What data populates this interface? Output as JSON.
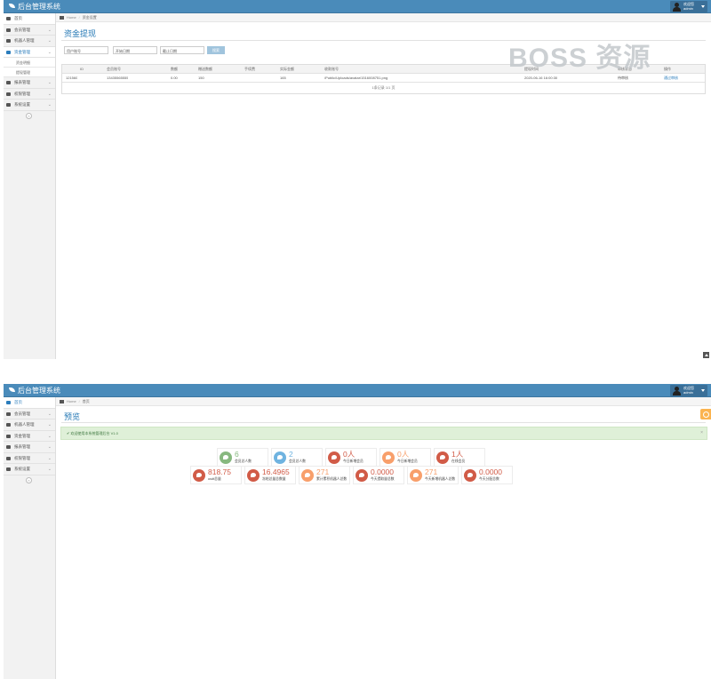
{
  "app": {
    "title": "后台管理系统"
  },
  "user": {
    "welcome": "欢迎您",
    "name": "admin"
  },
  "colors": {
    "navbar": "#4a8bba",
    "accent": "#2679b5",
    "green": "#87b87f",
    "blue": "#6fb3e0",
    "red": "#d15b47",
    "orange": "#f89f6b",
    "alert_bg": "#dff0d8"
  },
  "sidebar_icons": [
    "tachometer-icon",
    "edit-icon",
    "star-icon",
    "calendar-icon",
    "calendar-icon",
    "file-icon",
    "text-icon"
  ],
  "screen1": {
    "breadcrumb": {
      "home": "Home",
      "current": "资金设置"
    },
    "sidebar": {
      "home": "首页",
      "items": [
        "会员管理",
        "机器人管理",
        "资金管理",
        "报表管理",
        "权限管理",
        "系统设置"
      ],
      "submenu": [
        "资金明细",
        "提现管理"
      ]
    },
    "page_title": "资金提现",
    "filters": {
      "phone": "用户账号",
      "start": "开始日期",
      "end": "截止日期",
      "search": "搜索"
    },
    "table": {
      "headers": [
        "ID",
        "会员账号",
        "数额",
        "赠送数额",
        "手续费",
        "实际金额",
        "收款账号",
        "",
        "提现时间",
        "审核状态",
        "操作"
      ],
      "rows": [
        [
          "121560",
          "13435565555",
          "0.00",
          "150",
          "",
          "165",
          "/Public/Uploads/avatar/1516008751.png",
          "",
          "2020-06-16 16:00:30",
          "待审核",
          "通过审核"
        ]
      ],
      "footer": "1条记录 1/1 页"
    },
    "watermark": "BOSS 资源"
  },
  "screen2": {
    "breadcrumb": {
      "home": "Home",
      "current": "首页"
    },
    "sidebar": {
      "home": "首页",
      "items": [
        "会员管理",
        "机器人管理",
        "资金管理",
        "报表管理",
        "权限管理",
        "系统设置"
      ]
    },
    "page_title": "预览",
    "alert": "欢迎使用本系统管理后台 V1.0",
    "stats": [
      {
        "value": "6",
        "label": "会员总人数",
        "color": "#87b87f"
      },
      {
        "value": "2",
        "label": "会员总人数",
        "color": "#6fb3e0"
      },
      {
        "value": "0人",
        "label": "今日新增会员",
        "color": "#d15b47"
      },
      {
        "value": "0人",
        "label": "今日新增会员",
        "color": "#f89f6b"
      },
      {
        "value": "1人",
        "label": "在线会员",
        "color": "#d15b47"
      },
      {
        "value": "818.75",
        "label": "usdt总量",
        "color": "#d15b47"
      },
      {
        "value": "16.4965",
        "label": "冻结总量总数量",
        "color": "#d15b47"
      },
      {
        "value": "271",
        "label": "累计累积机器人总数",
        "color": "#f89f6b"
      },
      {
        "value": "0.0000",
        "label": "今天提取量总数",
        "color": "#d15b47"
      },
      {
        "value": "271",
        "label": "今天新增机器人总数",
        "color": "#f89f6b"
      },
      {
        "value": "0.0000",
        "label": "今天分配总数",
        "color": "#d15b47"
      }
    ]
  }
}
